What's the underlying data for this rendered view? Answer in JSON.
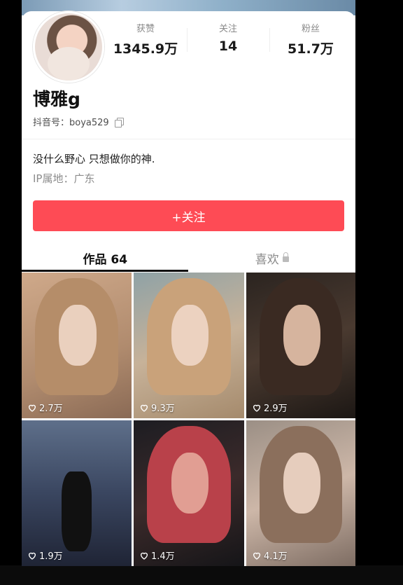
{
  "profile": {
    "name": "博雅g",
    "douyin_id": "抖音号：boya529",
    "bio": "没什么野心 只想做你的神.",
    "ip": "IP属地：广东"
  },
  "stats": [
    {
      "label": "获赞",
      "value": "1345.9万"
    },
    {
      "label": "关注",
      "value": "14"
    },
    {
      "label": "粉丝",
      "value": "51.7万"
    }
  ],
  "actions": {
    "follow_label": "+关注"
  },
  "tabs": [
    {
      "label": "作品 64"
    },
    {
      "label": "喜欢"
    }
  ],
  "videos": [
    {
      "likes": "2.7万"
    },
    {
      "likes": "9.3万"
    },
    {
      "likes": "2.9万"
    },
    {
      "likes": "1.9万"
    },
    {
      "likes": "1.4万"
    },
    {
      "likes": "4.1万"
    }
  ],
  "colors": {
    "accent": "#fe4b55",
    "text": "#111111"
  }
}
